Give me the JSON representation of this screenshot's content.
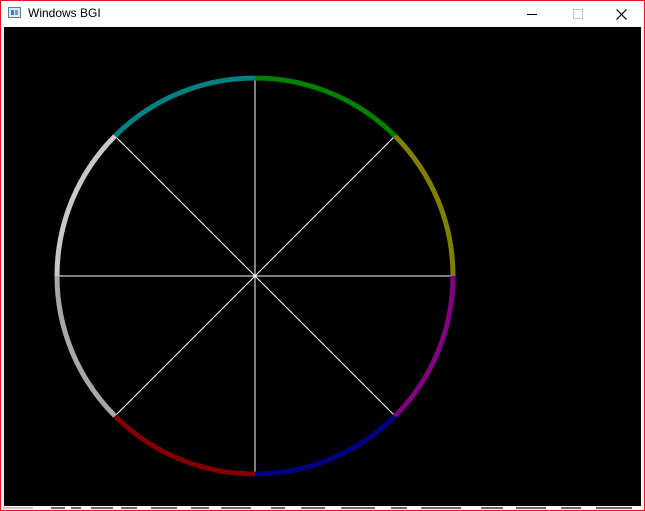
{
  "window": {
    "title": "Windows BGI"
  },
  "controls": {
    "minimize_icon": "minimize-icon",
    "maximize_icon": "maximize-icon",
    "close_icon": "close-icon"
  },
  "graphic": {
    "background": "#000000",
    "spoke_color": "#ffffff",
    "arc_colors": {
      "top_right": "#008000",
      "upper_right": "#808000",
      "lower_right": "#800080",
      "bottom_right": "#000080",
      "bottom_left": "#800000",
      "lower_left": "#a8a8a8",
      "upper_left": "#c8c8c8",
      "top_left": "#008080"
    }
  }
}
